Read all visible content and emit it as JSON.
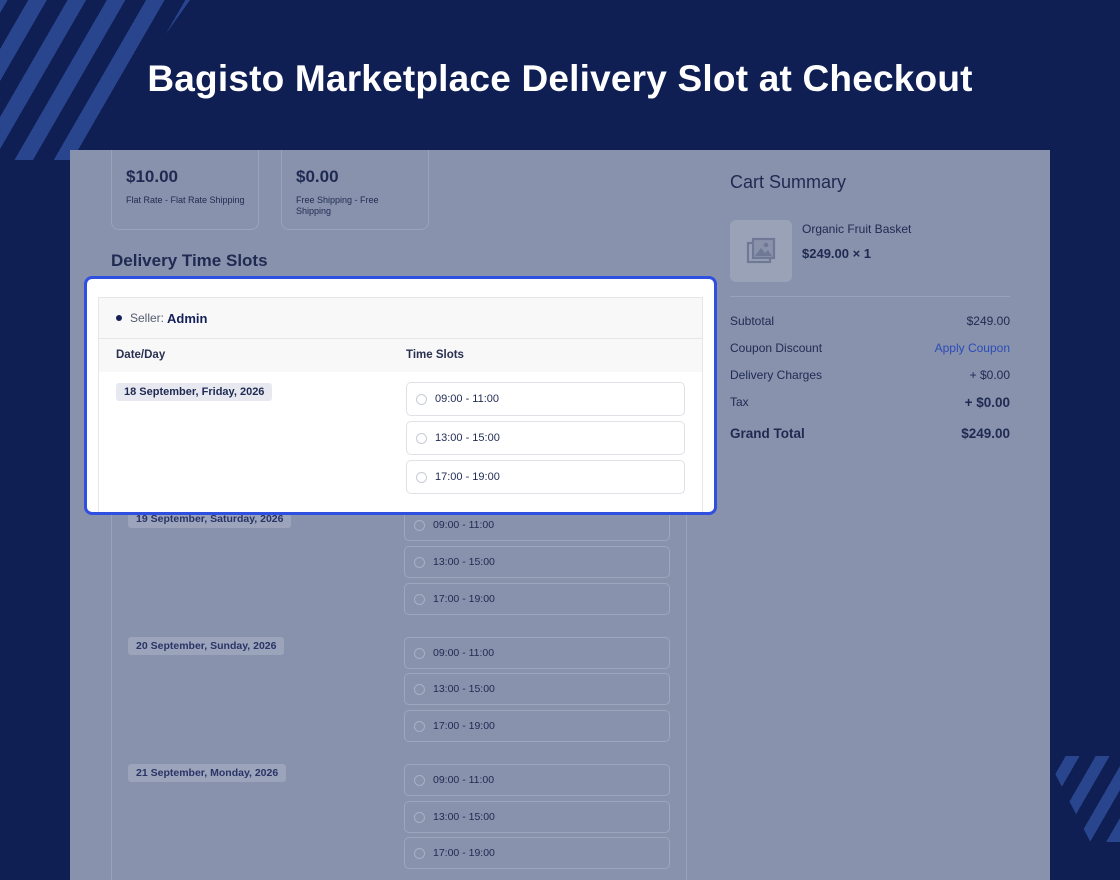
{
  "banner": {
    "title": "Bagisto Marketplace Delivery Slot at Checkout"
  },
  "shipping": [
    {
      "price": "$10.00",
      "desc": "Flat Rate - Flat Rate Shipping"
    },
    {
      "price": "$0.00",
      "desc": "Free Shipping - Free Shipping"
    }
  ],
  "delivery": {
    "title": "Delivery Time Slots",
    "seller_label": "Seller:",
    "seller_name": "Admin",
    "col_date": "Date/Day",
    "col_slots": "Time Slots",
    "days": [
      {
        "date": "18 September, Friday, 2026",
        "slots": [
          "09:00 - 11:00",
          "13:00 - 15:00",
          "17:00 - 19:00"
        ]
      },
      {
        "date": "19 September, Saturday, 2026",
        "slots": [
          "09:00 - 11:00",
          "13:00 - 15:00",
          "17:00 - 19:00"
        ]
      },
      {
        "date": "20 September, Sunday, 2026",
        "slots": [
          "09:00 - 11:00",
          "13:00 - 15:00",
          "17:00 - 19:00"
        ]
      },
      {
        "date": "21 September, Monday, 2026",
        "slots": [
          "09:00 - 11:00",
          "13:00 - 15:00",
          "17:00 - 19:00"
        ]
      }
    ]
  },
  "cart": {
    "title": "Cart Summary",
    "product_name": "Organic Fruit Basket",
    "product_price": "$249.00 × 1",
    "subtotal_label": "Subtotal",
    "subtotal_value": "$249.00",
    "coupon_label": "Coupon Discount",
    "coupon_value": "Apply Coupon",
    "delivery_label": "Delivery Charges",
    "delivery_value": "+ $0.00",
    "tax_label": "Tax",
    "tax_value": "+ $0.00",
    "total_label": "Grand Total",
    "total_value": "$249.00"
  },
  "colors": {
    "background": "#0f1f54",
    "highlight_border": "#2f4fe0",
    "link": "#2c4bb8"
  }
}
